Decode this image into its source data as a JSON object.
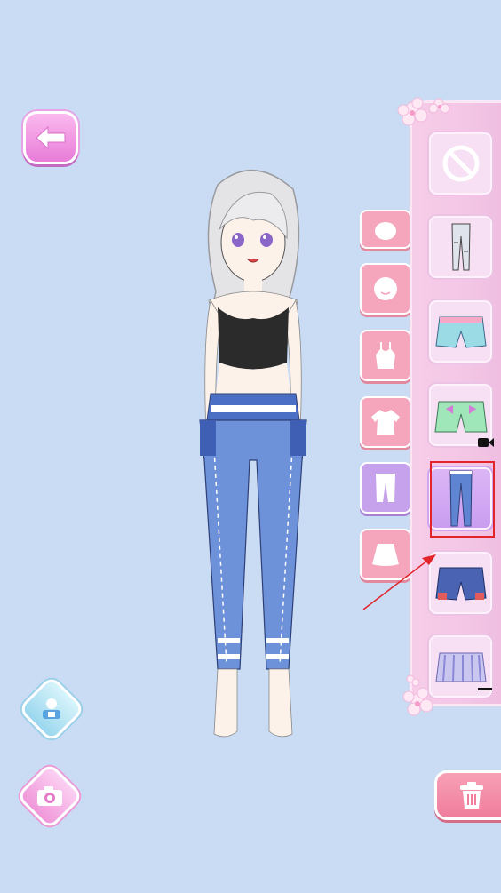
{
  "screen": {
    "background_color": "#c9dcf4",
    "accent_pink": "#f5a6bd",
    "accent_purple": "#c7a2ec",
    "highlight_color": "#e3242b"
  },
  "left_controls": {
    "back_icon": "arrow-left-icon",
    "avatar_icon": "avatar-icon",
    "camera_icon": "camera-icon"
  },
  "categories": [
    {
      "icon": "head-icon",
      "active": false
    },
    {
      "icon": "face-icon",
      "active": false
    },
    {
      "icon": "camisole-icon",
      "active": false
    },
    {
      "icon": "blouse-icon",
      "active": false
    },
    {
      "icon": "pants-icon",
      "active": true
    },
    {
      "icon": "skirt-icon",
      "active": false
    }
  ],
  "items": [
    {
      "icon": "none-icon",
      "selected": false
    },
    {
      "icon": "ripped-pants-icon",
      "selected": false
    },
    {
      "icon": "teal-shorts-icon",
      "selected": false
    },
    {
      "icon": "green-bow-shorts-icon",
      "selected": false,
      "locked_video": true
    },
    {
      "icon": "blue-jeans-icon",
      "selected": true
    },
    {
      "icon": "denim-shorts-icon",
      "selected": false
    },
    {
      "icon": "striped-shorts-icon",
      "selected": false
    }
  ],
  "trash_icon": "trash-icon",
  "video_icon": "video-camera-icon"
}
